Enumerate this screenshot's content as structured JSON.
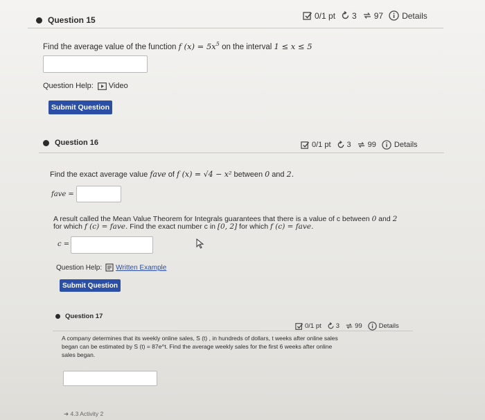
{
  "q15": {
    "title": "Question 15",
    "score": "0/1 pt",
    "retries": "3",
    "attempts": "97",
    "details": "Details",
    "prompt_pre": "Find the average value of the function",
    "function": "f (x) = 5x",
    "exponent": "5",
    "prompt_mid": "on the interval",
    "interval": "1 ≤ x ≤ 5",
    "help_label": "Question Help:",
    "help_link": "Video",
    "submit": "Submit Question"
  },
  "q16": {
    "title": "Question 16",
    "score": "0/1 pt",
    "retries": "3",
    "attempts": "99",
    "details": "Details",
    "prompt_pre": "Find the exact average value",
    "fave": "fave",
    "prompt_of": "of",
    "function": "f (x) = √4 − x²",
    "prompt_between": "between",
    "a": "0",
    "and": "and",
    "b": "2.",
    "fave_label": "fave =",
    "mvt_line1_pre": "A result called the Mean Value Theorem for Integrals guarantees that there is a value of c between",
    "mvt_zero": "0",
    "mvt_and": "and",
    "mvt_two": "2",
    "mvt_line2_pre": "for which",
    "mvt_eq": "f (c) = fave.",
    "mvt_line2_mid": "Find the exact number c in",
    "mvt_interval": "[0, 2]",
    "mvt_line2_for": "for which",
    "mvt_eq2": "f (c) = fave.",
    "c_label": "c =",
    "help_label": "Question Help:",
    "help_link": "Written Example",
    "submit": "Submit Question"
  },
  "q17": {
    "title": "Question 17",
    "score": "0/1 pt",
    "retries": "3",
    "attempts": "99",
    "details": "Details",
    "line1": "A company determines that its weekly online sales, S (t) , in hundreds of dollars, t weeks after online sales",
    "line2": "began can be estimated by S (t) = 87e^t. Find the average weekly sales for the first 6 weeks after online",
    "line3": "sales began.",
    "footer": "4.3 Activity 2"
  },
  "colors": {
    "button": "#2b4ea6",
    "dot": "#2b2b2b"
  }
}
